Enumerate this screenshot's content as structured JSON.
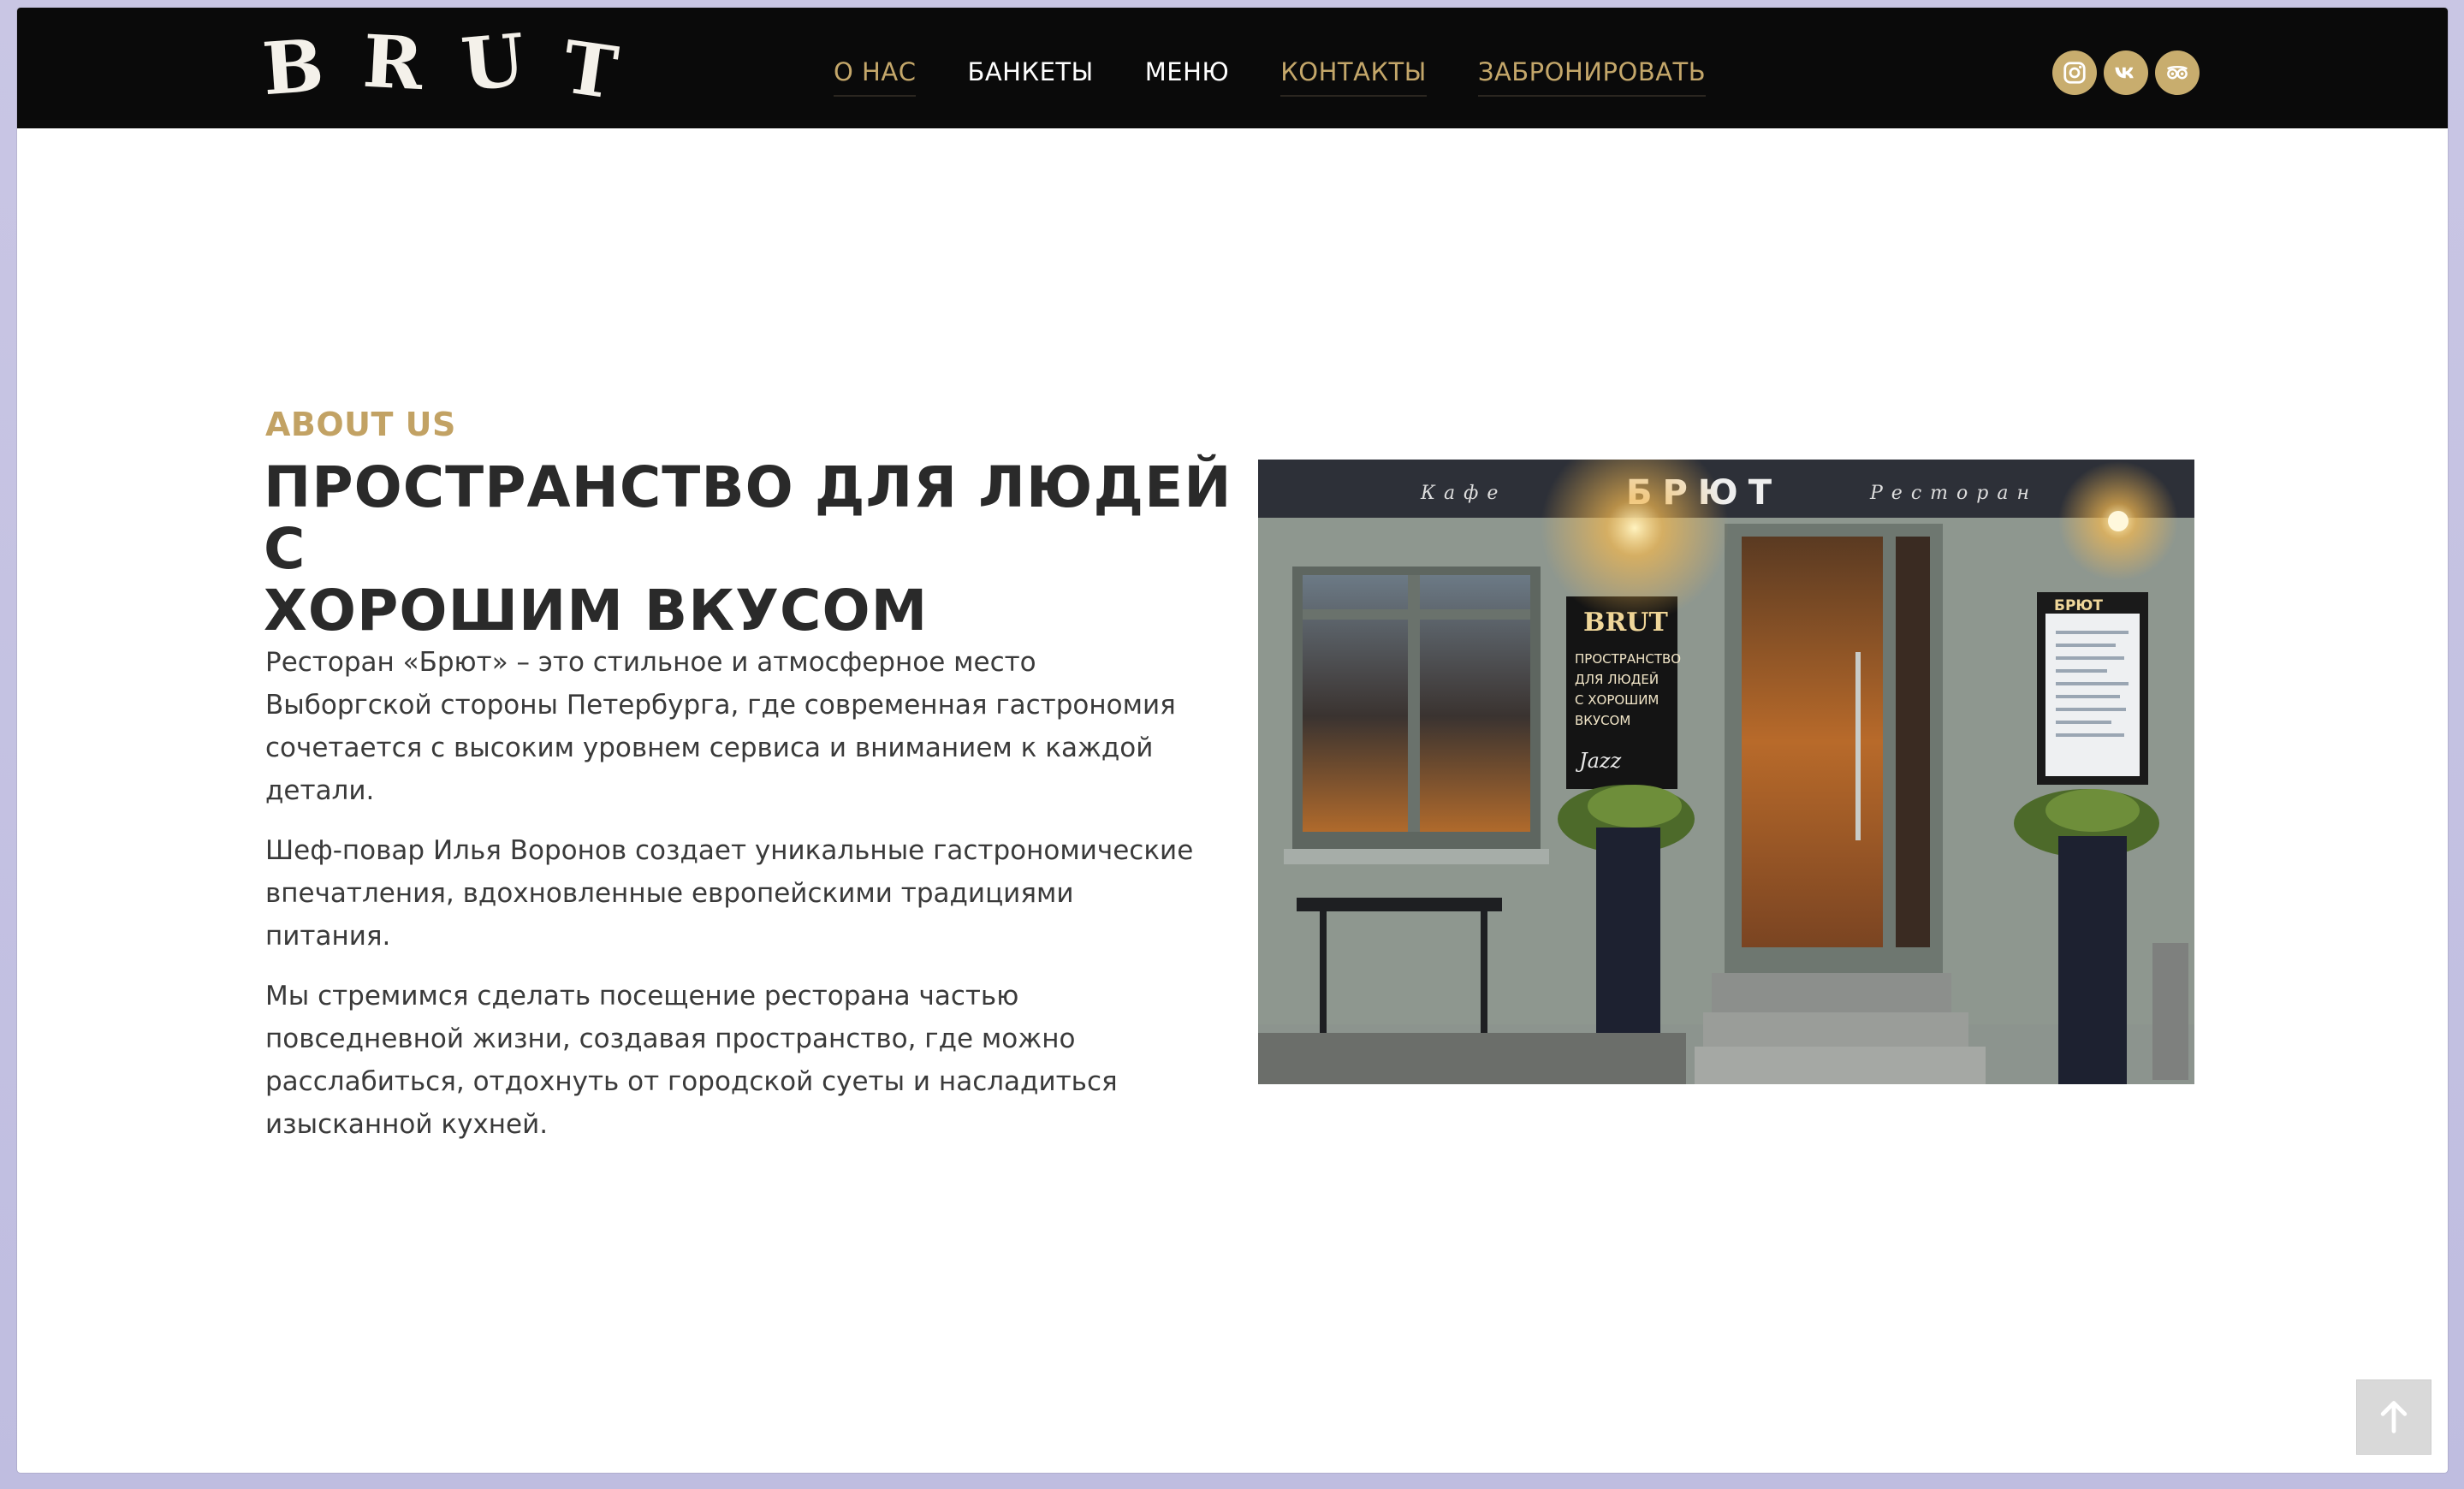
{
  "header": {
    "logo_letters": [
      "B",
      "R",
      "U",
      "T"
    ],
    "nav": [
      {
        "label": "О НАС",
        "active": true
      },
      {
        "label": "БАНКЕТЫ",
        "active": false
      },
      {
        "label": "МЕНЮ",
        "active": false
      },
      {
        "label": "КОНТАКТЫ",
        "active": false
      },
      {
        "label": "ЗАБРОНИРОВАТЬ",
        "active": false
      }
    ],
    "social": [
      "instagram-icon",
      "vk-icon",
      "tripadvisor-icon"
    ]
  },
  "about": {
    "eyebrow": "ABOUT US",
    "heading_line1": "ПРОСТРАНСТВО ДЛЯ ЛЮДЕЙ С",
    "heading_line2": "ХОРОШИМ ВКУСОМ",
    "paragraphs": [
      "Ресторан «Брют» – это стильное и атмосферное место Выборгской стороны Петербурга, где современная гастрономия сочетается с высоким уровнем сервиса и вниманием к каждой детали.",
      "Шеф-повар Илья Воронов создает уникальные гастрономические впечатления, вдохновленные европейскими традициями питания.",
      "Мы стремимся сделать посещение ресторана частью повседневной жизни, создавая пространство, где можно расслабиться, отдохнуть от городской суеты и насладиться изысканной кухней."
    ]
  },
  "photo": {
    "awning_left": "Кафе",
    "awning_center": "БРЮТ",
    "awning_right": "Ресторан",
    "board_title": "BRUT",
    "board_lines": [
      "ПРОСТРАНСТВО",
      "ДЛЯ ЛЮДЕЙ",
      "С ХОРОШИМ",
      "ВКУСОМ"
    ],
    "board_jazz": "Jazz",
    "menu_title": "БРЮТ"
  },
  "colors": {
    "accent_gold": "#c4a76a",
    "header_bg": "#0a0a0a"
  },
  "back_to_top_icon": "arrow-up-icon"
}
